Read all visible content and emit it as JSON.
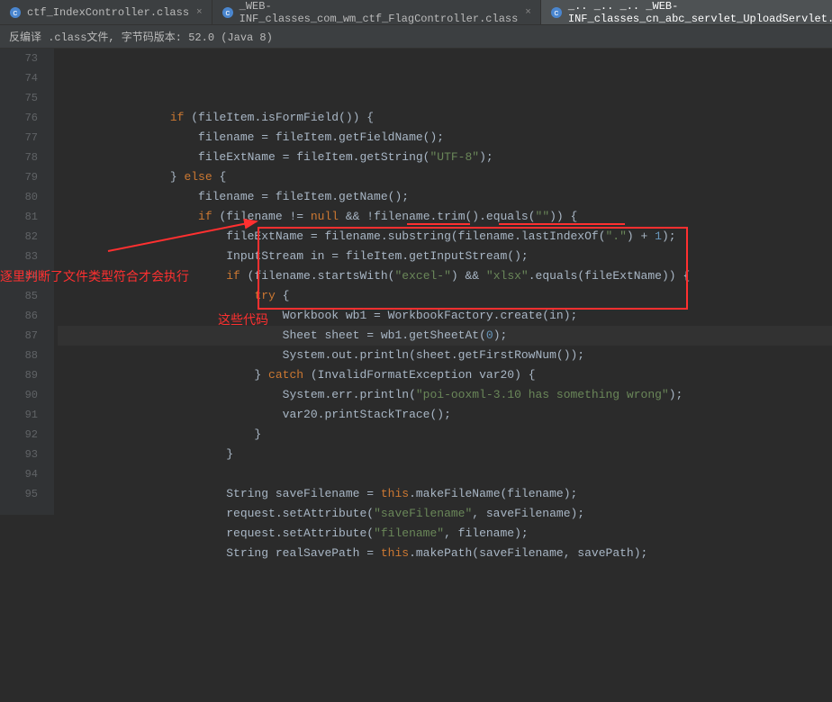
{
  "tabs": [
    {
      "label": "ctf_IndexController.class",
      "iconColor": "#4a86cf"
    },
    {
      "label": "_WEB-INF_classes_com_wm_ctf_FlagController.class",
      "iconColor": "#4a86cf"
    },
    {
      "label": "_.. _.. _.. _WEB-INF_classes_cn_abc_servlet_UploadServlet.class",
      "iconColor": "#4a86cf",
      "active": true
    }
  ],
  "info_bar": "反编译 .class文件, 字节码版本: 52.0 (Java 8)",
  "startLine": 73,
  "lines": [
    [
      {
        "t": "                "
      },
      {
        "t": "if",
        "c": "kw"
      },
      {
        "t": " (fileItem.isFormField()) {"
      }
    ],
    [
      {
        "t": "                    filename = fileItem.getFieldName();"
      }
    ],
    [
      {
        "t": "                    fileExtName = fileItem.getString("
      },
      {
        "t": "\"UTF-8\"",
        "c": "str"
      },
      {
        "t": ");"
      }
    ],
    [
      {
        "t": "                } "
      },
      {
        "t": "else",
        "c": "kw"
      },
      {
        "t": " {"
      }
    ],
    [
      {
        "t": "                    filename = fileItem.getName();"
      }
    ],
    [
      {
        "t": "                    "
      },
      {
        "t": "if",
        "c": "kw"
      },
      {
        "t": " (filename != "
      },
      {
        "t": "null",
        "c": "kw"
      },
      {
        "t": " && !filename.trim().equals("
      },
      {
        "t": "\"\"",
        "c": "str"
      },
      {
        "t": ")) {"
      }
    ],
    [
      {
        "t": "                        fileExtName = filename.substring(filename.lastIndexOf("
      },
      {
        "t": "\".\"",
        "c": "str"
      },
      {
        "t": ") + "
      },
      {
        "t": "1",
        "c": "num"
      },
      {
        "t": ");"
      }
    ],
    [
      {
        "t": "                        InputStream in = fileItem.getInputStream();"
      }
    ],
    [
      {
        "t": "                        "
      },
      {
        "t": "if",
        "c": "kw"
      },
      {
        "t": " (filename.startsWith("
      },
      {
        "t": "\"excel-\"",
        "c": "str"
      },
      {
        "t": ") && "
      },
      {
        "t": "\"xlsx\"",
        "c": "str"
      },
      {
        "t": ".equals(fileExtName)) {"
      }
    ],
    [
      {
        "t": "                            "
      },
      {
        "t": "try",
        "c": "kw"
      },
      {
        "t": " {"
      }
    ],
    [
      {
        "t": "                                Workbook wb1 = WorkbookFactory.create(in);"
      }
    ],
    [
      {
        "t": "                                Sheet sheet = wb1.getSheetAt("
      },
      {
        "t": "0",
        "c": "num"
      },
      {
        "t": ");"
      }
    ],
    [
      {
        "t": "                                System.out.println(sheet.getFirstRowNum());"
      }
    ],
    [
      {
        "t": "                            } "
      },
      {
        "t": "catch",
        "c": "kw"
      },
      {
        "t": " (InvalidFormatException var20) {"
      }
    ],
    [
      {
        "t": "                                System.err.println("
      },
      {
        "t": "\"poi-ooxml-3.10 has something wrong\"",
        "c": "str"
      },
      {
        "t": ");"
      }
    ],
    [
      {
        "t": "                                var20.printStackTrace();"
      }
    ],
    [
      {
        "t": "                            }"
      }
    ],
    [
      {
        "t": "                        }"
      }
    ],
    [
      {
        "t": ""
      }
    ],
    [
      {
        "t": "                        String saveFilename = "
      },
      {
        "t": "this",
        "c": "kw"
      },
      {
        "t": ".makeFileName(filename);"
      }
    ],
    [
      {
        "t": "                        request.setAttribute("
      },
      {
        "t": "\"saveFilename\"",
        "c": "str"
      },
      {
        "t": ", saveFilename);"
      }
    ],
    [
      {
        "t": "                        request.setAttribute("
      },
      {
        "t": "\"filename\"",
        "c": "str"
      },
      {
        "t": ", filename);"
      }
    ],
    [
      {
        "t": "                        String realSavePath = "
      },
      {
        "t": "this",
        "c": "kw"
      },
      {
        "t": ".makePath(saveFilename, savePath);"
      }
    ]
  ],
  "annotations": {
    "left": "逐里判断了文件类型符合才会执行",
    "right": "这些代码"
  }
}
